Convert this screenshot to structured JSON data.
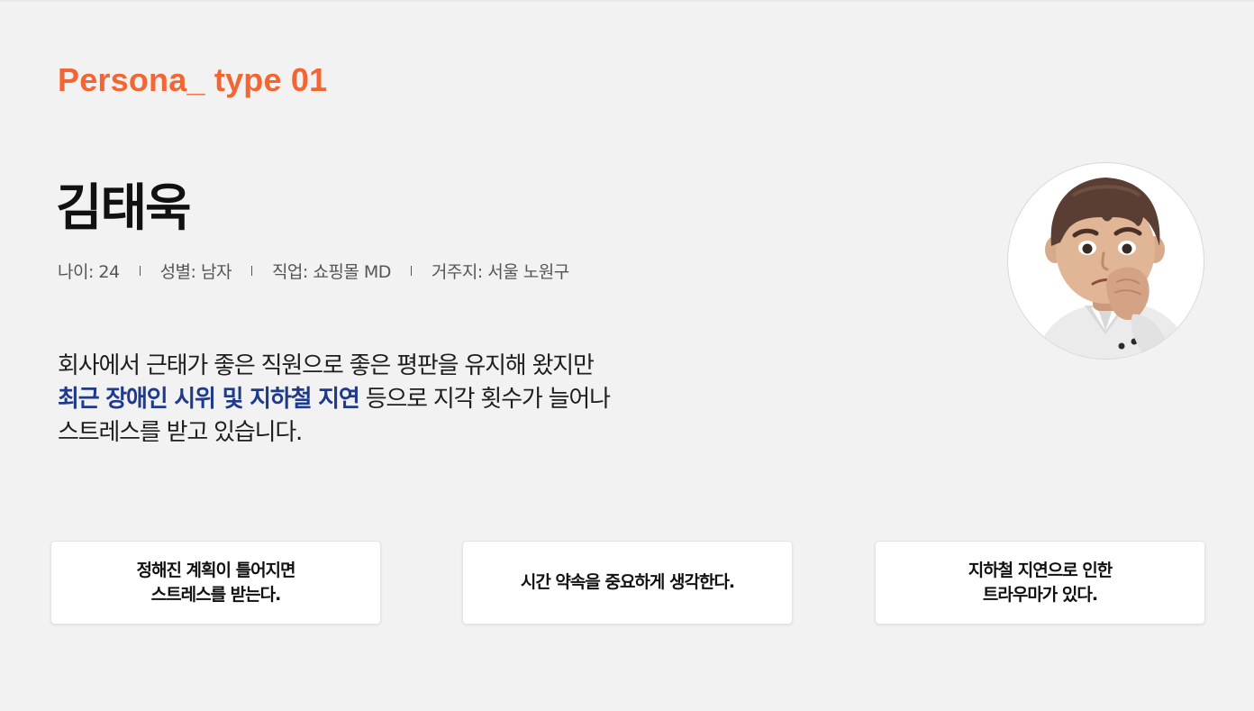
{
  "persona": {
    "label": "Persona_ type 01",
    "name": "김태욱",
    "meta": {
      "age": "나이: 24",
      "gender": "성별: 남자",
      "job": "직업: 쇼핑몰 MD",
      "residence": "거주지: 서울 노원구"
    },
    "description": {
      "line1": "회사에서 근태가 좋은 직원으로 좋은 평판을 유지해 왔지만",
      "highlight": "최근 장애인 시위 및 지하철 지연",
      "line2_rest": " 등으로 지각 횟수가 늘어나",
      "line3": "스트레스를 받고 있습니다."
    },
    "avatar_icon": "memoji-worried-man-icon",
    "colors": {
      "accent": "#f26633",
      "highlight": "#1f3a8a",
      "background": "#f2f2f2"
    }
  },
  "cards": [
    {
      "text": "정해진 계획이 틀어지면\n스트레스를 받는다."
    },
    {
      "text": "시간 약속을 중요하게 생각한다."
    },
    {
      "text": "지하철 지연으로 인한\n트라우마가 있다."
    }
  ]
}
